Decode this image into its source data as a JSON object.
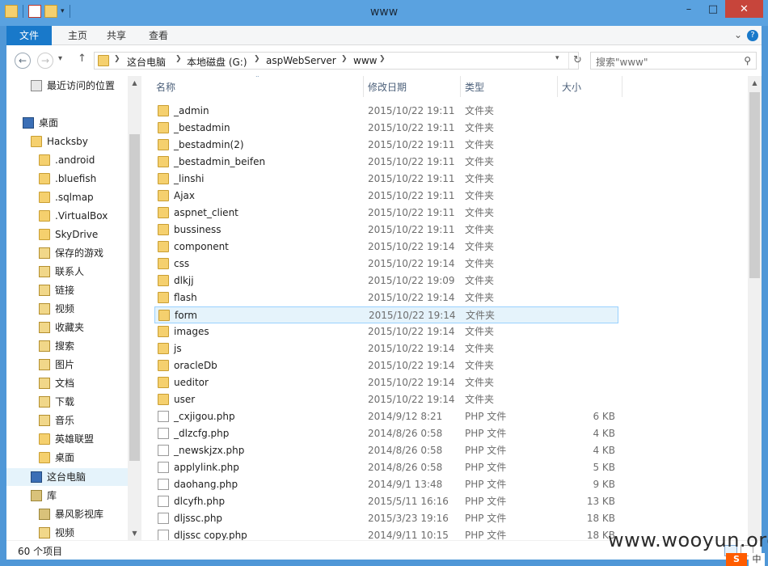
{
  "window": {
    "title": "www"
  },
  "ribbon": {
    "tabs": [
      "文件",
      "主页",
      "共享",
      "查看"
    ]
  },
  "address": {
    "crumbs": [
      "这台电脑",
      "本地磁盘 (G:)",
      "aspWebServer",
      "www"
    ]
  },
  "search": {
    "placeholder": "搜索\"www\""
  },
  "nav": {
    "items": [
      {
        "label": "最近访问的位置",
        "icon": "recent-places-icon"
      },
      {
        "label": "桌面",
        "icon": "desktop-icon"
      },
      {
        "label": "Hacksby",
        "icon": "user-folder-icon"
      },
      {
        "label": ".android",
        "icon": "folder-icon"
      },
      {
        "label": ".bluefish",
        "icon": "folder-icon"
      },
      {
        "label": ".sqlmap",
        "icon": "folder-icon"
      },
      {
        "label": ".VirtualBox",
        "icon": "folder-icon"
      },
      {
        "label": "SkyDrive",
        "icon": "folder-icon"
      },
      {
        "label": "保存的游戏",
        "icon": "saved-games-icon"
      },
      {
        "label": "联系人",
        "icon": "contacts-icon"
      },
      {
        "label": "链接",
        "icon": "links-icon"
      },
      {
        "label": "视频",
        "icon": "videos-icon"
      },
      {
        "label": "收藏夹",
        "icon": "favorites-icon"
      },
      {
        "label": "搜索",
        "icon": "searches-icon"
      },
      {
        "label": "图片",
        "icon": "pictures-icon"
      },
      {
        "label": "文档",
        "icon": "documents-icon"
      },
      {
        "label": "下载",
        "icon": "downloads-icon"
      },
      {
        "label": "音乐",
        "icon": "music-icon"
      },
      {
        "label": "英雄联盟",
        "icon": "folder-icon"
      },
      {
        "label": "桌面",
        "icon": "folder-icon"
      },
      {
        "label": "这台电脑",
        "icon": "computer-icon"
      },
      {
        "label": "库",
        "icon": "libraries-icon"
      },
      {
        "label": "暴风影视库",
        "icon": "library-icon"
      },
      {
        "label": "视频",
        "icon": "videos-icon"
      }
    ]
  },
  "columns": {
    "name": "名称",
    "date": "修改日期",
    "type": "类型",
    "size": "大小"
  },
  "files": [
    {
      "name": "_admin",
      "date": "2015/10/22 19:11",
      "type": "文件夹",
      "size": "",
      "kind": "folder"
    },
    {
      "name": "_bestadmin",
      "date": "2015/10/22 19:11",
      "type": "文件夹",
      "size": "",
      "kind": "folder"
    },
    {
      "name": "_bestadmin(2)",
      "date": "2015/10/22 19:11",
      "type": "文件夹",
      "size": "",
      "kind": "folder"
    },
    {
      "name": "_bestadmin_beifen",
      "date": "2015/10/22 19:11",
      "type": "文件夹",
      "size": "",
      "kind": "folder"
    },
    {
      "name": "_linshi",
      "date": "2015/10/22 19:11",
      "type": "文件夹",
      "size": "",
      "kind": "folder"
    },
    {
      "name": "Ajax",
      "date": "2015/10/22 19:11",
      "type": "文件夹",
      "size": "",
      "kind": "folder"
    },
    {
      "name": "aspnet_client",
      "date": "2015/10/22 19:11",
      "type": "文件夹",
      "size": "",
      "kind": "folder"
    },
    {
      "name": "bussiness",
      "date": "2015/10/22 19:11",
      "type": "文件夹",
      "size": "",
      "kind": "folder"
    },
    {
      "name": "component",
      "date": "2015/10/22 19:14",
      "type": "文件夹",
      "size": "",
      "kind": "folder"
    },
    {
      "name": "css",
      "date": "2015/10/22 19:14",
      "type": "文件夹",
      "size": "",
      "kind": "folder"
    },
    {
      "name": "dlkjj",
      "date": "2015/10/22 19:09",
      "type": "文件夹",
      "size": "",
      "kind": "folder"
    },
    {
      "name": "flash",
      "date": "2015/10/22 19:14",
      "type": "文件夹",
      "size": "",
      "kind": "folder"
    },
    {
      "name": "form",
      "date": "2015/10/22 19:14",
      "type": "文件夹",
      "size": "",
      "kind": "folder",
      "selected": true
    },
    {
      "name": "images",
      "date": "2015/10/22 19:14",
      "type": "文件夹",
      "size": "",
      "kind": "folder"
    },
    {
      "name": "js",
      "date": "2015/10/22 19:14",
      "type": "文件夹",
      "size": "",
      "kind": "folder"
    },
    {
      "name": "oracleDb",
      "date": "2015/10/22 19:14",
      "type": "文件夹",
      "size": "",
      "kind": "folder"
    },
    {
      "name": "ueditor",
      "date": "2015/10/22 19:14",
      "type": "文件夹",
      "size": "",
      "kind": "folder"
    },
    {
      "name": "user",
      "date": "2015/10/22 19:14",
      "type": "文件夹",
      "size": "",
      "kind": "folder"
    },
    {
      "name": "_cxjigou.php",
      "date": "2014/9/12 8:21",
      "type": "PHP 文件",
      "size": "6 KB",
      "kind": "file"
    },
    {
      "name": "_dlzcfg.php",
      "date": "2014/8/26 0:58",
      "type": "PHP 文件",
      "size": "4 KB",
      "kind": "file"
    },
    {
      "name": "_newskjzx.php",
      "date": "2014/8/26 0:58",
      "type": "PHP 文件",
      "size": "4 KB",
      "kind": "file"
    },
    {
      "name": "applylink.php",
      "date": "2014/8/26 0:58",
      "type": "PHP 文件",
      "size": "5 KB",
      "kind": "file"
    },
    {
      "name": "daohang.php",
      "date": "2014/9/1 13:48",
      "type": "PHP 文件",
      "size": "9 KB",
      "kind": "file"
    },
    {
      "name": "dlcyfh.php",
      "date": "2015/5/11 16:16",
      "type": "PHP 文件",
      "size": "13 KB",
      "kind": "file"
    },
    {
      "name": "dljssc.php",
      "date": "2015/3/23 19:16",
      "type": "PHP 文件",
      "size": "18 KB",
      "kind": "file"
    },
    {
      "name": "dljssc copy.php",
      "date": "2014/9/11 10:15",
      "type": "PHP 文件",
      "size": "18 KB",
      "kind": "file"
    }
  ],
  "status": {
    "count": "60 个项目"
  },
  "watermark": "www.wooyun.org",
  "ime": {
    "logo": "S",
    "mode": "中"
  },
  "colors": {
    "folder": "#f5d06e",
    "ribbon_file_tab": "#1979ca",
    "title_bar": "#5aa2e0",
    "selection": "#e5f3fb"
  }
}
